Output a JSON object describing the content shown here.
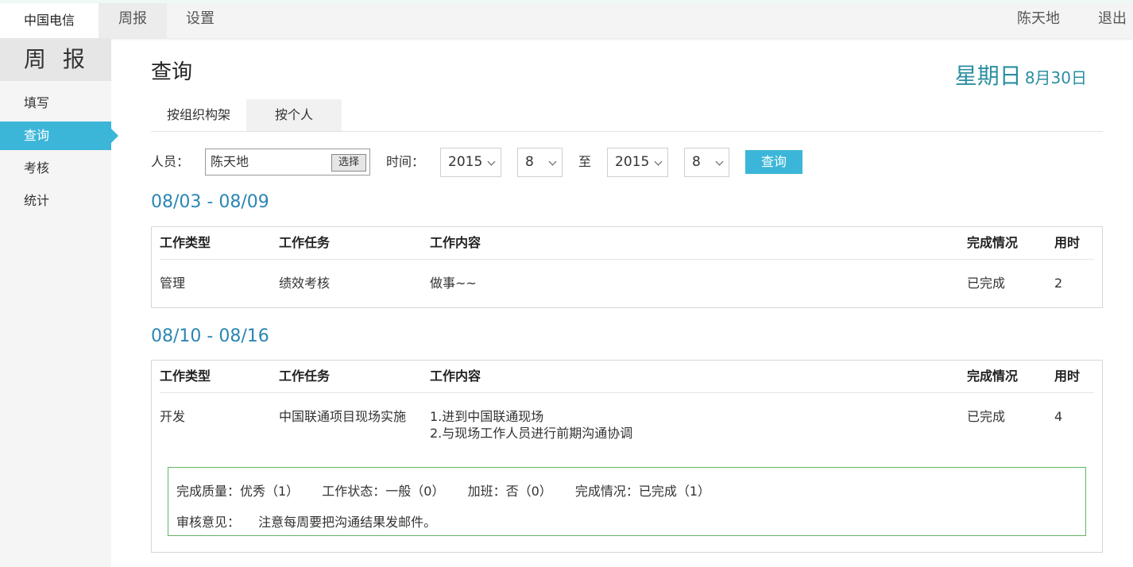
{
  "header": {
    "brand": "中国电信",
    "nav": [
      {
        "label": "周报",
        "active": true
      },
      {
        "label": "设置",
        "active": false
      }
    ],
    "user_name": "陈天地",
    "logout": "退出"
  },
  "sidebar": {
    "title": "周 报",
    "items": [
      {
        "label": "填写",
        "active": false
      },
      {
        "label": "查询",
        "active": true
      },
      {
        "label": "考核",
        "active": false
      },
      {
        "label": "统计",
        "active": false
      }
    ]
  },
  "main": {
    "title": "查询",
    "weekday": "星期日",
    "date": "8月30日",
    "tabs": [
      {
        "label": "按组织构架",
        "active": true
      },
      {
        "label": "按个人",
        "active": false
      }
    ],
    "filter": {
      "person_label": "人员：",
      "person_value": "陈天地",
      "choose_btn": "选择",
      "time_label": "时间：",
      "from_year": "2015",
      "from_month": "8",
      "to_label": "至",
      "to_year": "2015",
      "to_month": "8",
      "query_btn": "查询"
    },
    "table_headers": [
      "工作类型",
      "工作任务",
      "工作内容",
      "完成情况",
      "用时"
    ],
    "weeks": [
      {
        "range": "08/03 - 08/09",
        "rows": [
          {
            "type": "管理",
            "task": "绩效考核",
            "content_line1": "做事~~",
            "status": "已完成",
            "hours": "2"
          }
        ]
      },
      {
        "range": "08/10 - 08/16",
        "rows": [
          {
            "type": "开发",
            "task": "中国联通项目现场实施",
            "content_line1": "1.进到中国联通现场",
            "content_line2": "2.与现场工作人员进行前期沟通协调",
            "status": "已完成",
            "hours": "4"
          }
        ],
        "review": {
          "quality": "完成质量：优秀（1）",
          "work_status": "工作状态：一般（0）",
          "overtime": "加班：否（0）",
          "completion": "完成情况：已完成（1）",
          "opinion_label": "审核意见：",
          "opinion": "注意每周要把沟通结果发邮件。"
        }
      }
    ]
  },
  "colors": {
    "accent": "#3cb6d8",
    "date_color": "#2a8fa0",
    "week_heading": "#2b86b3",
    "review_border": "#63b560"
  }
}
